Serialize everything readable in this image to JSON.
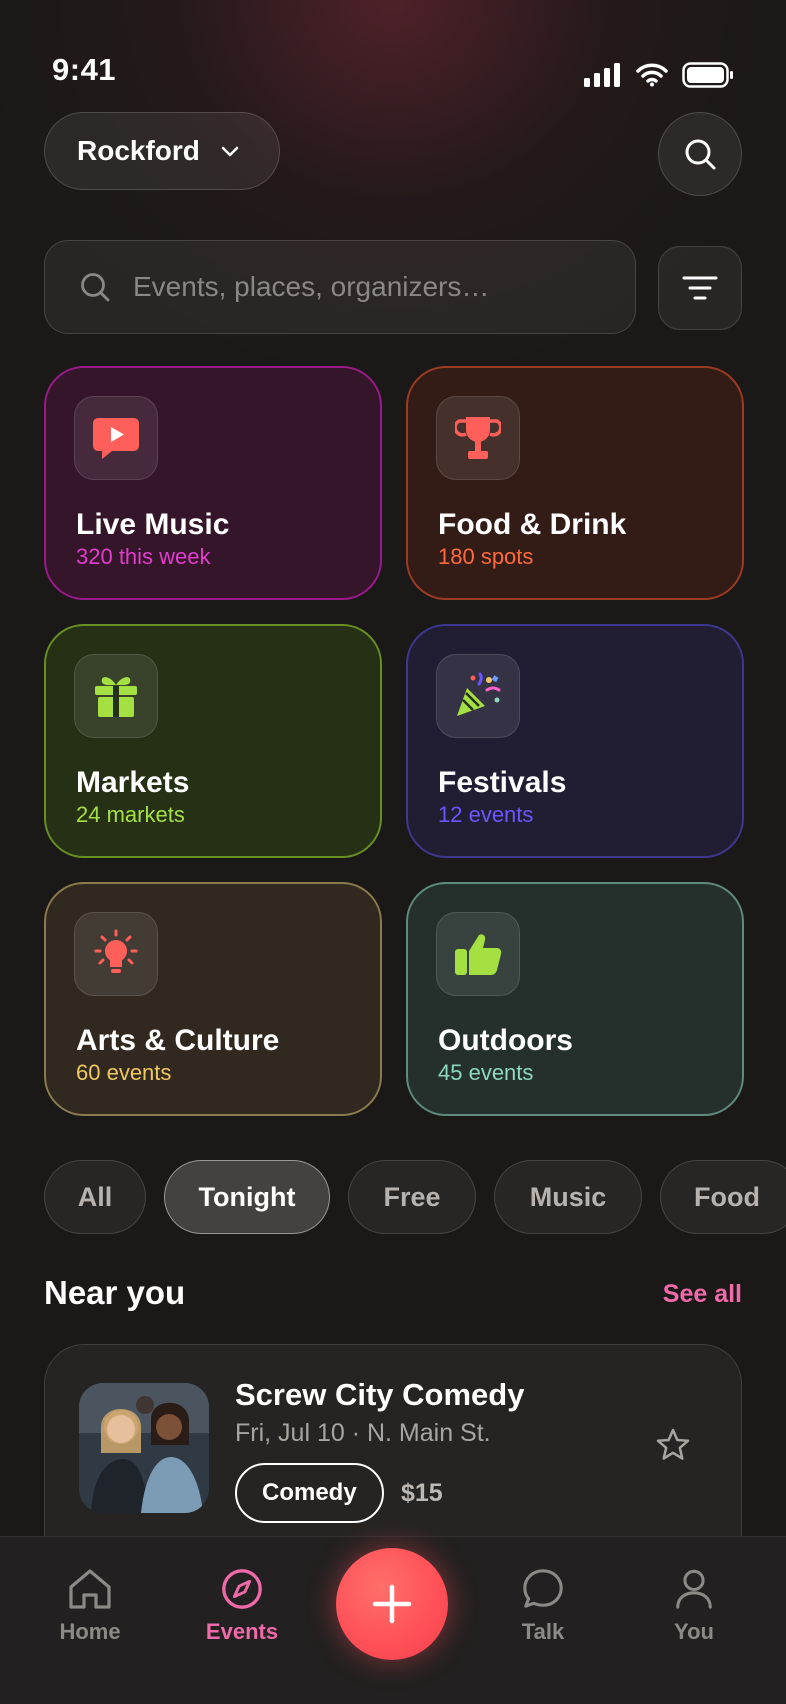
{
  "status_bar": {
    "time": "9:41"
  },
  "header": {
    "location": "Rockford",
    "location_icon": "chevron-down-icon",
    "search_button_icon": "search-icon"
  },
  "search": {
    "placeholder": "Events, places, organizers…",
    "value": "",
    "filter_icon": "filter-icon"
  },
  "categories": [
    {
      "title": "Live Music",
      "subtitle": "320 this week",
      "icon": "video-chat-icon",
      "accent": "#e23bcf"
    },
    {
      "title": "Food & Drink",
      "subtitle": "180 spots",
      "icon": "trophy-icon",
      "accent": "#ff6a3c"
    },
    {
      "title": "Markets",
      "subtitle": "24 markets",
      "icon": "gift-icon",
      "accent": "#a5e043"
    },
    {
      "title": "Festivals",
      "subtitle": "12 events",
      "icon": "party-popper-icon",
      "accent": "#6b55ff"
    },
    {
      "title": "Arts & Culture",
      "subtitle": "60 events",
      "icon": "lightbulb-icon",
      "accent": "#f0c862"
    },
    {
      "title": "Outdoors",
      "subtitle": "45 events",
      "icon": "thumbs-up-icon",
      "accent": "#8cd7bf"
    }
  ],
  "chips": [
    {
      "label": "All",
      "active": false
    },
    {
      "label": "Tonight",
      "active": true
    },
    {
      "label": "Free",
      "active": false
    },
    {
      "label": "Music",
      "active": false
    },
    {
      "label": "Food",
      "active": false
    }
  ],
  "near_you": {
    "title": "Near you",
    "see_all": "See all",
    "events": [
      {
        "name": "Screw City Comedy",
        "meta": "Fri, Jul 10 · N. Main St.",
        "tag": "Comedy",
        "price": "$15",
        "favorite": false
      }
    ]
  },
  "tabbar": {
    "items": [
      {
        "label": "Home",
        "icon": "home-icon",
        "active": false
      },
      {
        "label": "Events",
        "icon": "compass-icon",
        "active": true
      },
      {
        "label": "Talk",
        "icon": "chat-bubble-icon",
        "active": false
      },
      {
        "label": "You",
        "icon": "user-icon",
        "active": false
      }
    ],
    "fab_icon": "plus-icon"
  },
  "colors": {
    "accent_pink": "#f06aaa",
    "fab": "#ff4f57",
    "background": "#1b1918"
  }
}
